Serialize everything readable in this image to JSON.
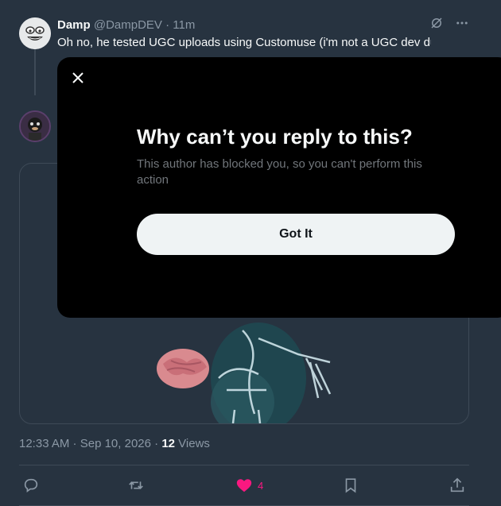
{
  "parent_tweet": {
    "name": "Damp",
    "handle": "@DampDEV",
    "separator": " · ",
    "time": "11m",
    "text": "Oh no, he tested UGC uploads using Customuse (i'm not a UGC dev dumbass lol)"
  },
  "tweet_meta": {
    "time": "12:33 AM",
    "date": "Sep 10, 2026",
    "separator": " · ",
    "views_count": "12",
    "views_label": " Views"
  },
  "actions": {
    "reply_icon": "reply-icon",
    "retweet_icon": "retweet-icon",
    "like_icon": "heart-filled-icon",
    "like_count": "4",
    "bookmark_icon": "bookmark-icon",
    "share_icon": "share-icon"
  },
  "modal": {
    "title": "Why can’t you reply to this?",
    "body": "This author has blocked you, so you can't perform this action",
    "button_label": "Got It",
    "close_icon": "close-icon"
  },
  "colors": {
    "background": "#273340",
    "modal_bg": "#000000",
    "like": "#f91880",
    "muted": "#8b98a5"
  }
}
